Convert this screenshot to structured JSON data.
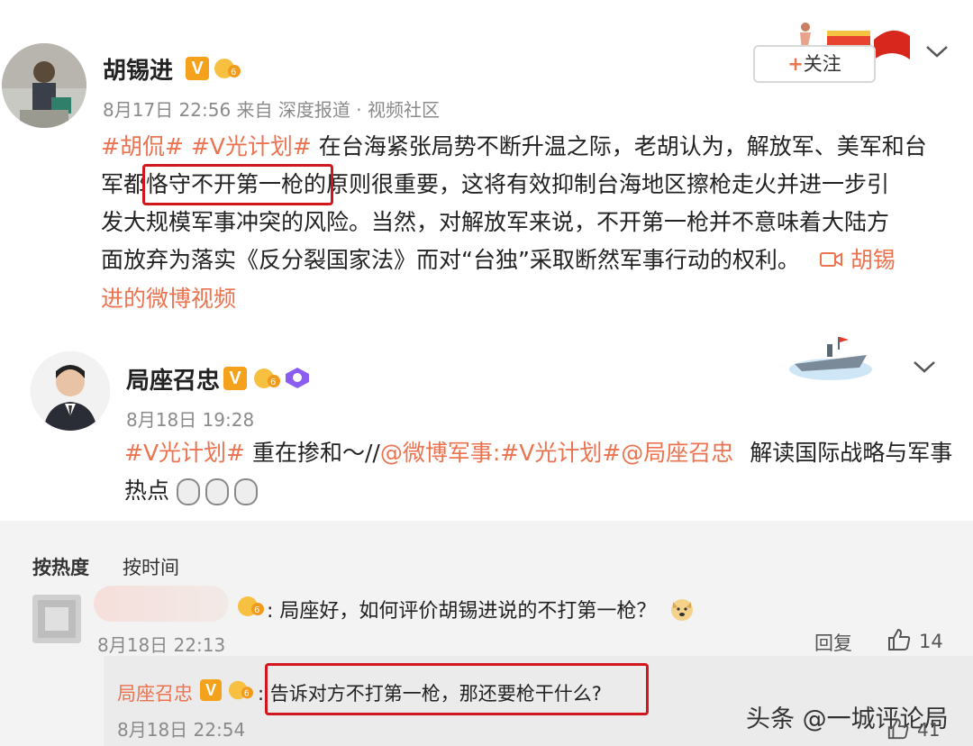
{
  "post1": {
    "author": "胡锡进",
    "meta": "8月17日 22:56 来自 深度报道 · 视频社区",
    "follow_label": "关注",
    "follow_plus": "+",
    "line1_tags": "#胡侃# #V光计划#",
    "line1_text": "在台海紧张局势不断升温之际，老胡认为，解放军、美军和台",
    "line2_pre": "军都",
    "line2_highlight": "恪守不开第一枪的",
    "line2_post": "原则很重要，这将有效抑制台海地区擦枪走火并进一步引",
    "line3": "发大规模军事冲突的风险。当然，对解放军来说，不开第一枪并不意味着大陆方",
    "line4": "面放弃为落实《反分裂国家法》而对“台独”采取断然军事行动的权利。",
    "video_link_1": "胡锡",
    "video_link_2": "进的微博视频"
  },
  "post2": {
    "author": "局座召忠",
    "meta": "8月18日 19:28",
    "tag1": "#V光计划#",
    "text1": "重在掺和～//",
    "mention1": "@微博军事",
    "sep": ":",
    "tag2": "#V光计划#",
    "mention2": "@局座召忠",
    "text2": "解读国际战略与军事",
    "line2": "热点"
  },
  "comments": {
    "sort_hot": "按热度",
    "sort_time": "按时间",
    "comment1": {
      "text": "局座好，如何评价胡锡进说的不打第一枪？",
      "time": "8月18日 22:13",
      "reply_label": "回复",
      "likes": "14"
    },
    "reply1": {
      "author": "局座召忠",
      "text": "告诉对方不打第一枪，那还要枪干什么?",
      "time": "8月18日 22:54",
      "likes": "41"
    }
  },
  "watermark": "头条 @一城评论局",
  "colors": {
    "tag": "#eb7350",
    "highlight_box": "#d2161e",
    "vip_badge": "#f4a11c",
    "comment_bg": "#f3f3f3"
  }
}
